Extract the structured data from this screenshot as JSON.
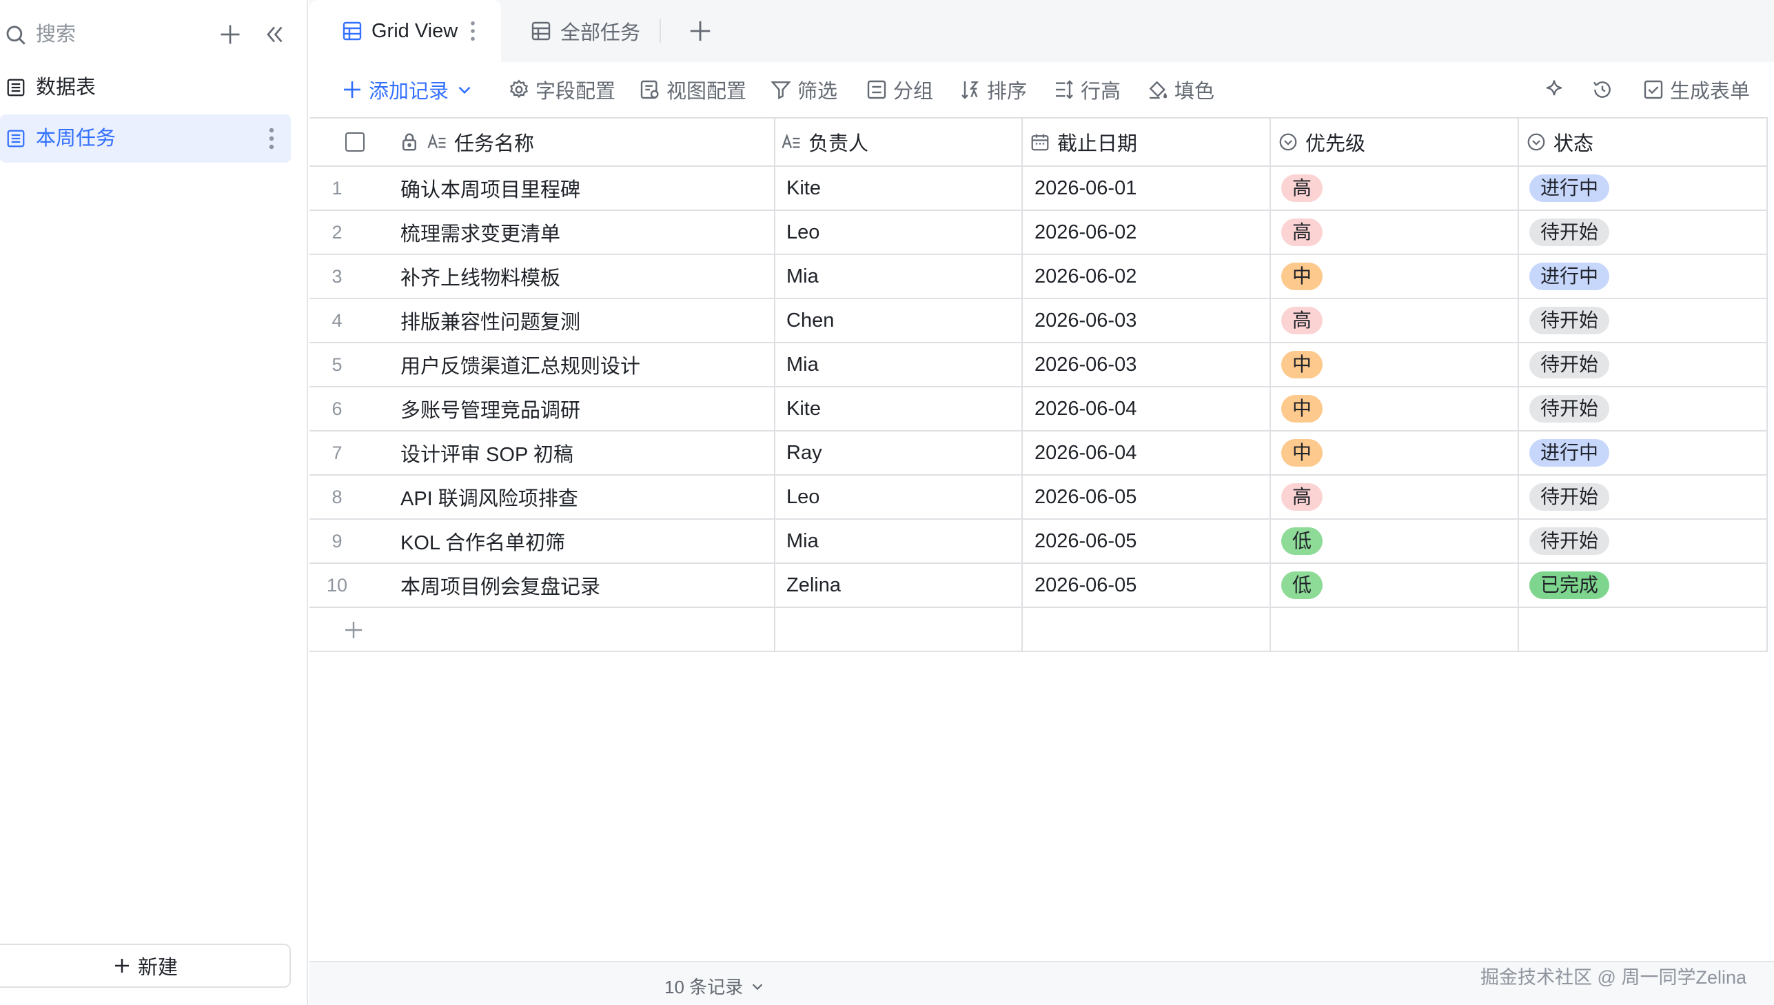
{
  "sidebar": {
    "search_placeholder": "搜索",
    "items": [
      {
        "label": "数据表"
      },
      {
        "label": "本周任务"
      }
    ],
    "new_label": "新建"
  },
  "tabs": [
    {
      "label": "Grid View"
    },
    {
      "label": "全部任务"
    }
  ],
  "toolbar": {
    "add_record": "添加记录",
    "field_config": "字段配置",
    "view_config": "视图配置",
    "filter": "筛选",
    "group": "分组",
    "sort": "排序",
    "row_height": "行高",
    "fill_color": "填色",
    "generate_form": "生成表单"
  },
  "columns": [
    "任务名称",
    "负责人",
    "截止日期",
    "优先级",
    "状态"
  ],
  "rows": [
    {
      "num": "1",
      "task": "确认本周项目里程碑",
      "owner": "Kite",
      "due": "2026-06-01",
      "priority": "高",
      "status": "进行中"
    },
    {
      "num": "2",
      "task": "梳理需求变更清单",
      "owner": "Leo",
      "due": "2026-06-02",
      "priority": "高",
      "status": "待开始"
    },
    {
      "num": "3",
      "task": "补齐上线物料模板",
      "owner": "Mia",
      "due": "2026-06-02",
      "priority": "中",
      "status": "进行中"
    },
    {
      "num": "4",
      "task": "排版兼容性问题复测",
      "owner": "Chen",
      "due": "2026-06-03",
      "priority": "高",
      "status": "待开始"
    },
    {
      "num": "5",
      "task": "用户反馈渠道汇总规则设计",
      "owner": "Mia",
      "due": "2026-06-03",
      "priority": "中",
      "status": "待开始"
    },
    {
      "num": "6",
      "task": "多账号管理竞品调研",
      "owner": "Kite",
      "due": "2026-06-04",
      "priority": "中",
      "status": "待开始"
    },
    {
      "num": "7",
      "task": "设计评审 SOP 初稿",
      "owner": "Ray",
      "due": "2026-06-04",
      "priority": "中",
      "status": "进行中"
    },
    {
      "num": "8",
      "task": "API 联调风险项排查",
      "owner": "Leo",
      "due": "2026-06-05",
      "priority": "高",
      "status": "待开始"
    },
    {
      "num": "9",
      "task": "KOL 合作名单初筛",
      "owner": "Mia",
      "due": "2026-06-05",
      "priority": "低",
      "status": "待开始"
    },
    {
      "num": "10",
      "task": "本周项目例会复盘记录",
      "owner": "Zelina",
      "due": "2026-06-05",
      "priority": "低",
      "status": "已完成"
    }
  ],
  "tag_colors": {
    "高": "#fbd3d3",
    "中": "#fdc98c",
    "低": "#8edb98",
    "进行中": "#c7d7fb",
    "待开始": "#e4e5e7",
    "已完成": "#7ed58d"
  },
  "footer": {
    "record_count": "10 条记录",
    "watermark": "掘金技术社区 @ 周一同学Zelina"
  }
}
